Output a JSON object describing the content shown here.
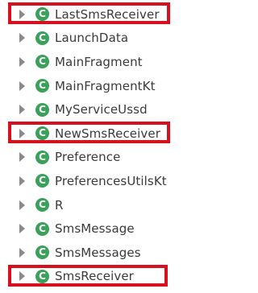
{
  "tree": {
    "items": [
      {
        "label": "LastSmsReceiver",
        "icon": "class-icon",
        "icon_letter": "C",
        "highlighted": true
      },
      {
        "label": "LaunchData",
        "icon": "class-icon",
        "icon_letter": "C",
        "highlighted": false
      },
      {
        "label": "MainFragment",
        "icon": "class-icon",
        "icon_letter": "C",
        "highlighted": false
      },
      {
        "label": "MainFragmentKt",
        "icon": "class-icon",
        "icon_letter": "C",
        "highlighted": false
      },
      {
        "label": "MyServiceUssd",
        "icon": "class-icon",
        "icon_letter": "C",
        "highlighted": false
      },
      {
        "label": "NewSmsReceiver",
        "icon": "class-icon",
        "icon_letter": "C",
        "highlighted": true
      },
      {
        "label": "Preference",
        "icon": "class-icon",
        "icon_letter": "C",
        "highlighted": false
      },
      {
        "label": "PreferencesUtilsKt",
        "icon": "class-icon",
        "icon_letter": "C",
        "highlighted": false
      },
      {
        "label": "R",
        "icon": "class-icon",
        "icon_letter": "C",
        "highlighted": false
      },
      {
        "label": "SmsMessage",
        "icon": "class-icon",
        "icon_letter": "C",
        "highlighted": false
      },
      {
        "label": "SmsMessages",
        "icon": "class-icon",
        "icon_letter": "C",
        "highlighted": false
      },
      {
        "label": "SmsReceiver",
        "icon": "class-icon",
        "icon_letter": "C",
        "highlighted": true
      }
    ]
  },
  "colors": {
    "class_icon": "#3aa05a",
    "highlight_border": "#d6101e",
    "expand_arrow": "#8a8a8a",
    "text": "#3b3b3b"
  }
}
